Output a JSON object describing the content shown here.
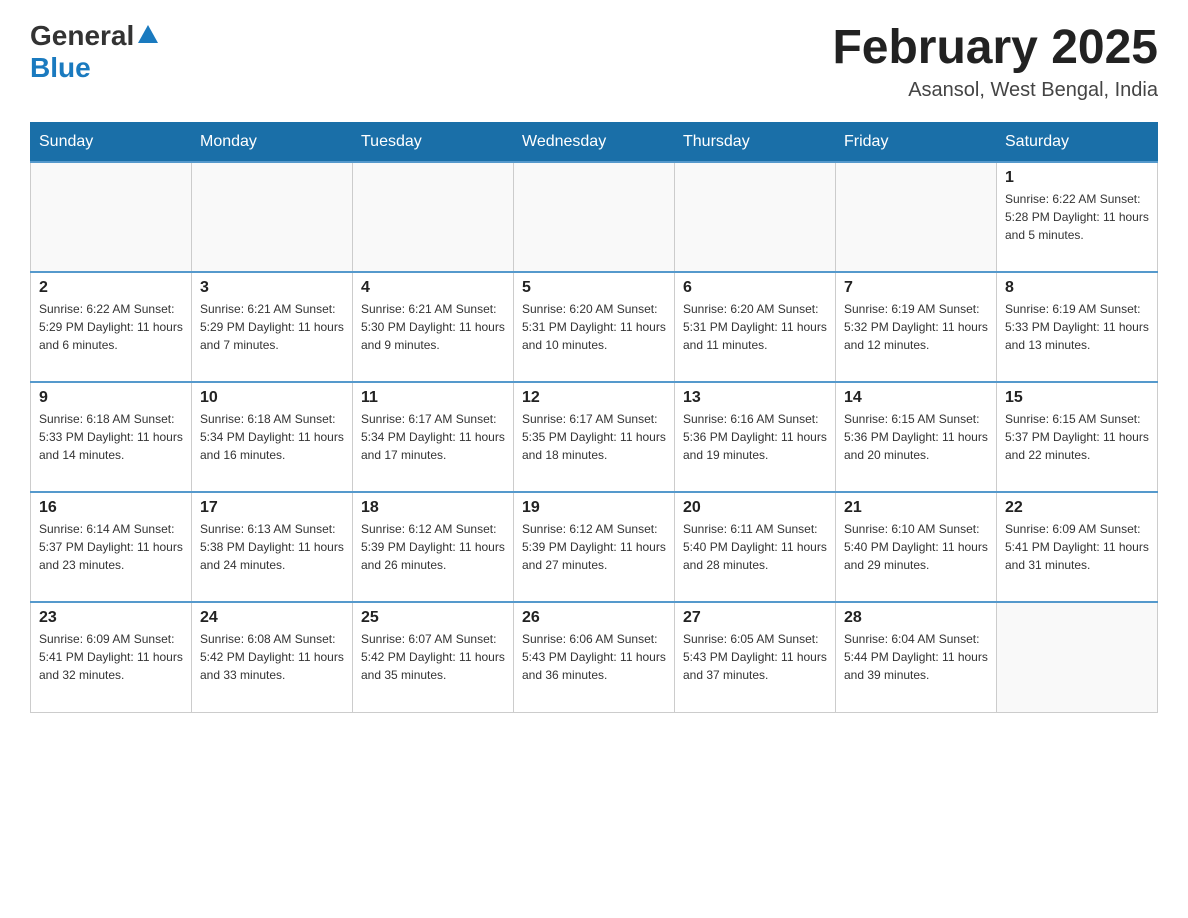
{
  "header": {
    "logo_general": "General",
    "logo_blue": "Blue",
    "month_title": "February 2025",
    "location": "Asansol, West Bengal, India"
  },
  "days_of_week": [
    "Sunday",
    "Monday",
    "Tuesday",
    "Wednesday",
    "Thursday",
    "Friday",
    "Saturday"
  ],
  "weeks": [
    [
      {
        "day": "",
        "info": ""
      },
      {
        "day": "",
        "info": ""
      },
      {
        "day": "",
        "info": ""
      },
      {
        "day": "",
        "info": ""
      },
      {
        "day": "",
        "info": ""
      },
      {
        "day": "",
        "info": ""
      },
      {
        "day": "1",
        "info": "Sunrise: 6:22 AM\nSunset: 5:28 PM\nDaylight: 11 hours and 5 minutes."
      }
    ],
    [
      {
        "day": "2",
        "info": "Sunrise: 6:22 AM\nSunset: 5:29 PM\nDaylight: 11 hours and 6 minutes."
      },
      {
        "day": "3",
        "info": "Sunrise: 6:21 AM\nSunset: 5:29 PM\nDaylight: 11 hours and 7 minutes."
      },
      {
        "day": "4",
        "info": "Sunrise: 6:21 AM\nSunset: 5:30 PM\nDaylight: 11 hours and 9 minutes."
      },
      {
        "day": "5",
        "info": "Sunrise: 6:20 AM\nSunset: 5:31 PM\nDaylight: 11 hours and 10 minutes."
      },
      {
        "day": "6",
        "info": "Sunrise: 6:20 AM\nSunset: 5:31 PM\nDaylight: 11 hours and 11 minutes."
      },
      {
        "day": "7",
        "info": "Sunrise: 6:19 AM\nSunset: 5:32 PM\nDaylight: 11 hours and 12 minutes."
      },
      {
        "day": "8",
        "info": "Sunrise: 6:19 AM\nSunset: 5:33 PM\nDaylight: 11 hours and 13 minutes."
      }
    ],
    [
      {
        "day": "9",
        "info": "Sunrise: 6:18 AM\nSunset: 5:33 PM\nDaylight: 11 hours and 14 minutes."
      },
      {
        "day": "10",
        "info": "Sunrise: 6:18 AM\nSunset: 5:34 PM\nDaylight: 11 hours and 16 minutes."
      },
      {
        "day": "11",
        "info": "Sunrise: 6:17 AM\nSunset: 5:34 PM\nDaylight: 11 hours and 17 minutes."
      },
      {
        "day": "12",
        "info": "Sunrise: 6:17 AM\nSunset: 5:35 PM\nDaylight: 11 hours and 18 minutes."
      },
      {
        "day": "13",
        "info": "Sunrise: 6:16 AM\nSunset: 5:36 PM\nDaylight: 11 hours and 19 minutes."
      },
      {
        "day": "14",
        "info": "Sunrise: 6:15 AM\nSunset: 5:36 PM\nDaylight: 11 hours and 20 minutes."
      },
      {
        "day": "15",
        "info": "Sunrise: 6:15 AM\nSunset: 5:37 PM\nDaylight: 11 hours and 22 minutes."
      }
    ],
    [
      {
        "day": "16",
        "info": "Sunrise: 6:14 AM\nSunset: 5:37 PM\nDaylight: 11 hours and 23 minutes."
      },
      {
        "day": "17",
        "info": "Sunrise: 6:13 AM\nSunset: 5:38 PM\nDaylight: 11 hours and 24 minutes."
      },
      {
        "day": "18",
        "info": "Sunrise: 6:12 AM\nSunset: 5:39 PM\nDaylight: 11 hours and 26 minutes."
      },
      {
        "day": "19",
        "info": "Sunrise: 6:12 AM\nSunset: 5:39 PM\nDaylight: 11 hours and 27 minutes."
      },
      {
        "day": "20",
        "info": "Sunrise: 6:11 AM\nSunset: 5:40 PM\nDaylight: 11 hours and 28 minutes."
      },
      {
        "day": "21",
        "info": "Sunrise: 6:10 AM\nSunset: 5:40 PM\nDaylight: 11 hours and 29 minutes."
      },
      {
        "day": "22",
        "info": "Sunrise: 6:09 AM\nSunset: 5:41 PM\nDaylight: 11 hours and 31 minutes."
      }
    ],
    [
      {
        "day": "23",
        "info": "Sunrise: 6:09 AM\nSunset: 5:41 PM\nDaylight: 11 hours and 32 minutes."
      },
      {
        "day": "24",
        "info": "Sunrise: 6:08 AM\nSunset: 5:42 PM\nDaylight: 11 hours and 33 minutes."
      },
      {
        "day": "25",
        "info": "Sunrise: 6:07 AM\nSunset: 5:42 PM\nDaylight: 11 hours and 35 minutes."
      },
      {
        "day": "26",
        "info": "Sunrise: 6:06 AM\nSunset: 5:43 PM\nDaylight: 11 hours and 36 minutes."
      },
      {
        "day": "27",
        "info": "Sunrise: 6:05 AM\nSunset: 5:43 PM\nDaylight: 11 hours and 37 minutes."
      },
      {
        "day": "28",
        "info": "Sunrise: 6:04 AM\nSunset: 5:44 PM\nDaylight: 11 hours and 39 minutes."
      },
      {
        "day": "",
        "info": ""
      }
    ]
  ]
}
